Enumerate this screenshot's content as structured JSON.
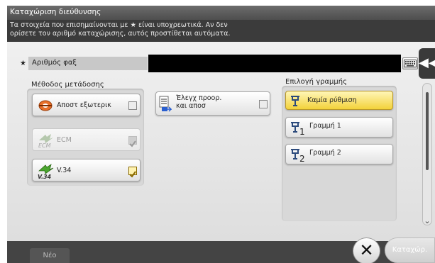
{
  "window": {
    "title": "Καταχώριση διεύθυνσης",
    "info_line1": "Τα στοιχεία που επισημαίνονται με ★ είναι υποχρεωτικά. Αν δεν",
    "info_line2": "ορίσετε τον αριθμό καταχώρισης, αυτός προστίθεται αυτόματα."
  },
  "fax": {
    "required_mark": "★",
    "label": "Αριθμός φαξ",
    "value": ""
  },
  "transmission": {
    "label": "Μέθοδος μετάδοσης",
    "options": [
      {
        "label": "Αποστ εξωτερικ",
        "checked": false,
        "enabled": true
      },
      {
        "label": "ECM",
        "checked": true,
        "enabled": false
      },
      {
        "label": "V.34",
        "checked": true,
        "enabled": true
      }
    ]
  },
  "confirm": {
    "line1": "Έλεγχ προορ.",
    "line2": "και αποσ",
    "checked": false
  },
  "line_selection": {
    "label": "Επιλογή γραμμής",
    "options": [
      {
        "label": "Καμία ρύθμιση",
        "sub": "",
        "selected": true
      },
      {
        "label": "Γραμμή 1",
        "sub": "1",
        "selected": false
      },
      {
        "label": "Γραμμή 2",
        "sub": "2",
        "selected": false
      }
    ]
  },
  "side_tab": "◀◀",
  "footer": {
    "new_tab": "Νέο",
    "close": "✕",
    "ok": "Καταχώρ."
  },
  "colors": {
    "selected": "#f3d23a",
    "check": "#8a6a00",
    "ecm_icon": "#4f8f2f",
    "v34_icon": "#4aa52e"
  }
}
